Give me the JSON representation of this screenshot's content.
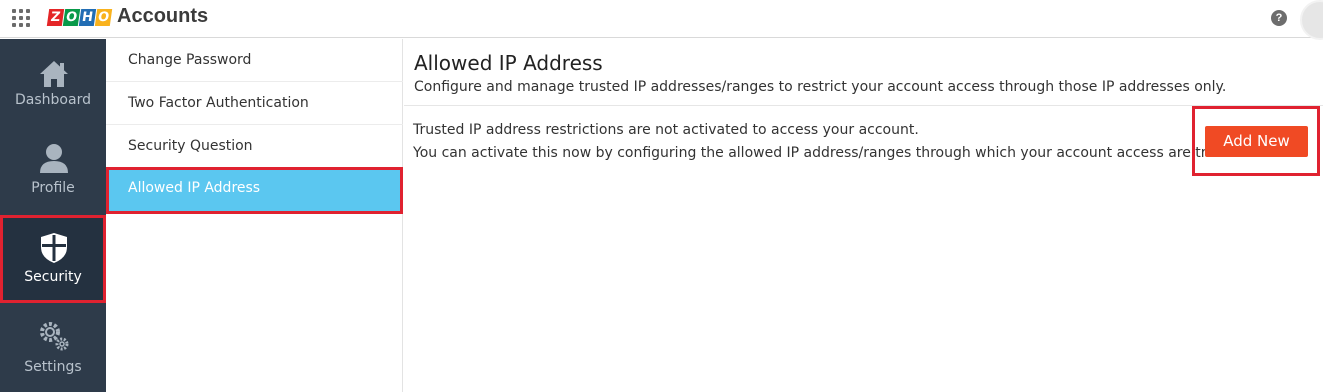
{
  "header": {
    "logo_letters": [
      "Z",
      "O",
      "H",
      "O"
    ],
    "logo_colors": [
      "#e42527",
      "#089949",
      "#226db4",
      "#f9b21d"
    ],
    "app_title": "Accounts",
    "help_glyph": "?"
  },
  "sidebar": {
    "items": [
      {
        "label": "Dashboard",
        "icon": "home-icon"
      },
      {
        "label": "Profile",
        "icon": "user-icon"
      },
      {
        "label": "Security",
        "icon": "shield-icon"
      },
      {
        "label": "Settings",
        "icon": "gear-icon"
      }
    ],
    "active": "Security"
  },
  "submenu": {
    "items": [
      {
        "label": "Change Password"
      },
      {
        "label": "Two Factor Authentication"
      },
      {
        "label": "Security Question"
      },
      {
        "label": "Allowed IP Address"
      }
    ],
    "active": "Allowed IP Address"
  },
  "main": {
    "title": "Allowed IP Address",
    "description": "Configure and manage trusted IP addresses/ranges to restrict your account access through those IP addresses only.",
    "notice_line1": "Trusted IP address restrictions are not activated to access your account.",
    "notice_line2": "You can activate this now by configuring the allowed IP address/ranges through which your account access are trusted.",
    "add_button_label": "Add New"
  },
  "colors": {
    "sidebar_bg": "#2e3b4a",
    "active_submenu": "#5bc7f0",
    "add_button": "#f04a24",
    "highlight_border": "#e02230"
  }
}
